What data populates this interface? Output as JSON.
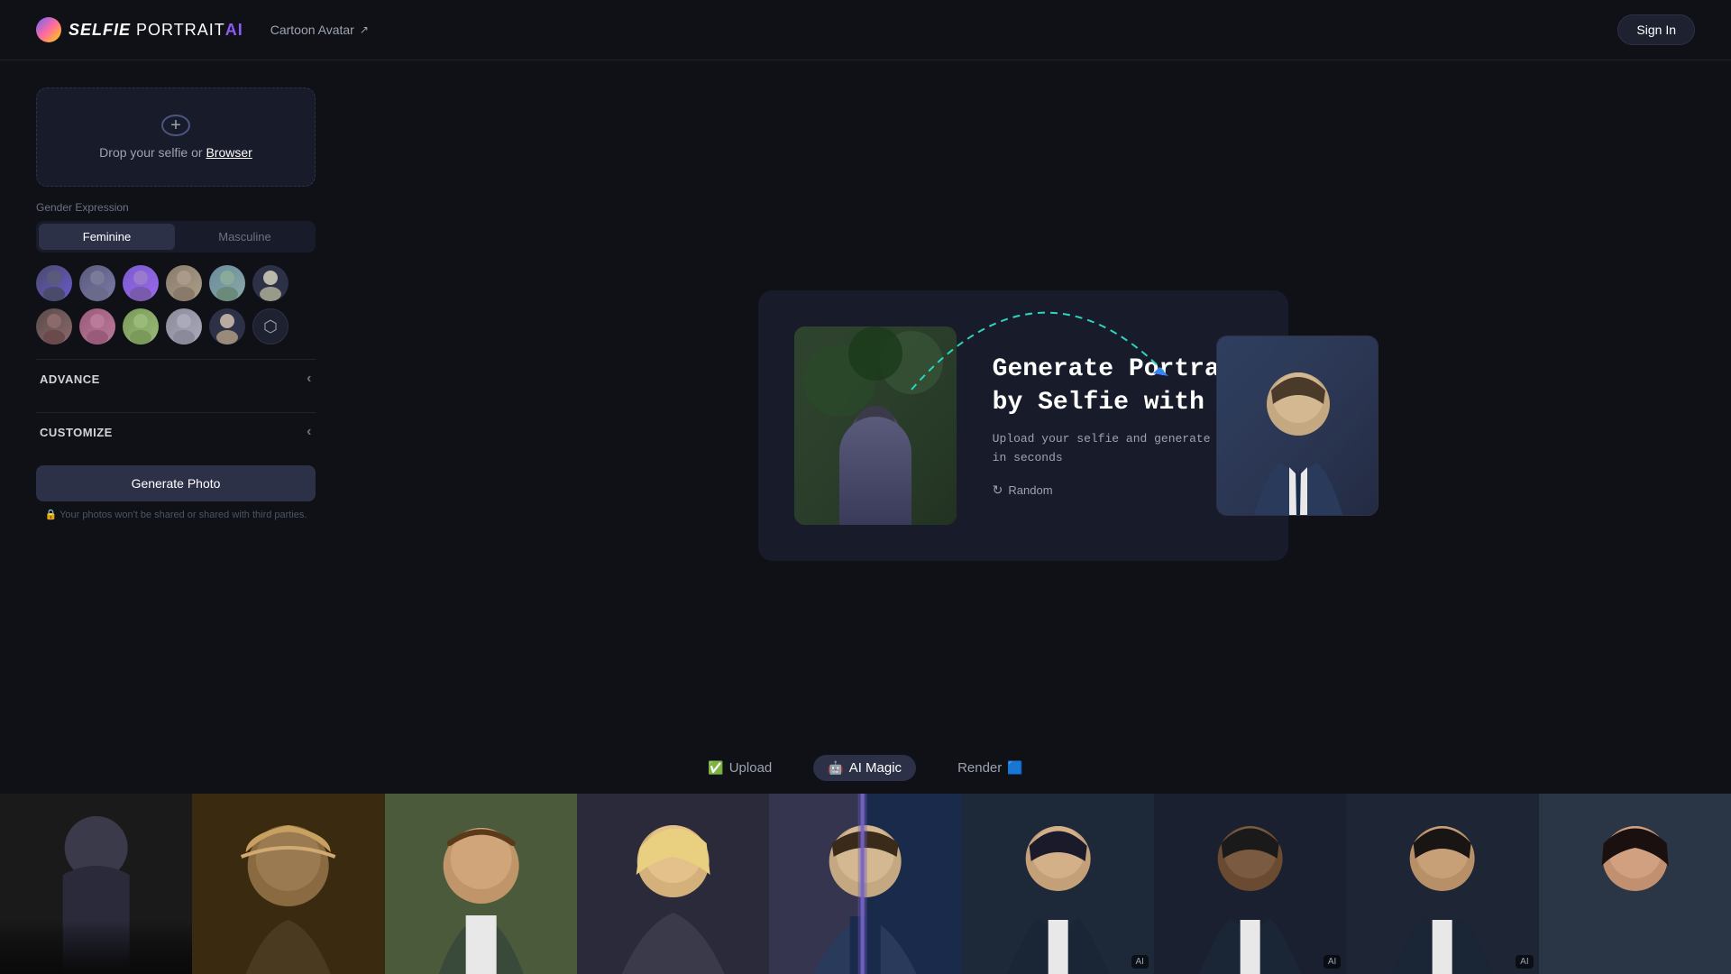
{
  "app": {
    "title": "SELFIE PORTRAIT AI"
  },
  "header": {
    "logo_selfie": "SELFIE",
    "logo_portrait": " PORTRAIT",
    "logo_ai": "AI",
    "nav_link": "Cartoon Avatar",
    "sign_in": "Sign In"
  },
  "left_panel": {
    "upload_text": "Drop your selfie or",
    "upload_link": "Browser",
    "gender_label": "Gender Expression",
    "gender_feminine": "Feminine",
    "gender_masculine": "Masculine",
    "advance_label": "ADVANCE",
    "customize_label": "CUSTOMIZE",
    "generate_btn": "Generate Photo",
    "privacy_note": "🔒 Your photos won't be shared or shared with third parties."
  },
  "hero": {
    "title": "Generate Portrait\nby Selfie with AI",
    "subtitle": "Upload your selfie and generate photo\nin seconds",
    "random_btn": "Random"
  },
  "tabs": [
    {
      "icon": "✅",
      "label": "Upload",
      "active": false
    },
    {
      "icon": "🤖",
      "label": "AI Magic",
      "active": true
    },
    {
      "icon": "⬛",
      "label": "Render",
      "active": false,
      "suffix_icon": "🟦"
    }
  ],
  "gallery": {
    "items": [
      {
        "id": "gi1",
        "has_ai": false
      },
      {
        "id": "gi2",
        "has_ai": false
      },
      {
        "id": "gi3",
        "has_ai": false
      },
      {
        "id": "gi4",
        "has_ai": false
      },
      {
        "id": "gi5",
        "has_ai": true,
        "has_overlay": true
      },
      {
        "id": "gi6",
        "has_ai": true
      },
      {
        "id": "gi7",
        "has_ai": true
      },
      {
        "id": "gi8",
        "has_ai": true
      },
      {
        "id": "gi9",
        "has_ai": false
      }
    ]
  },
  "icons": {
    "plus": "+",
    "chevron_left": "‹",
    "refresh": "↻",
    "lock": "🔒"
  }
}
